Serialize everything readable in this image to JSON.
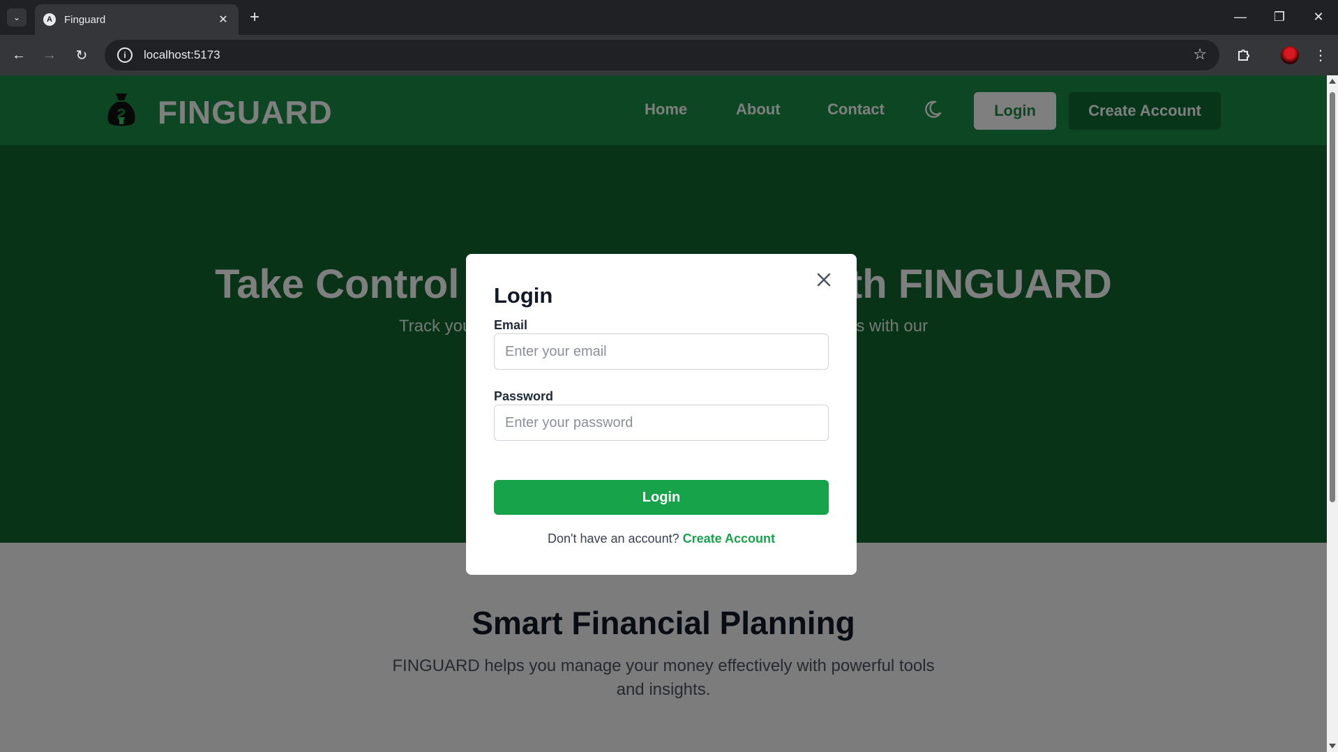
{
  "browser": {
    "tab_title": "Finguard",
    "url": "localhost:5173"
  },
  "site": {
    "brand": "FINGUARD",
    "nav": [
      {
        "label": "Home"
      },
      {
        "label": "About"
      },
      {
        "label": "Contact"
      }
    ],
    "login_label": "Login",
    "create_account_label": "Create Account"
  },
  "hero": {
    "title": "Take Control of Your Finances with FINGUARD",
    "subtitle": "Track your income, expenses, and achieve your financial goals with our"
  },
  "features": {
    "title": "Smart Financial Planning",
    "description": "FINGUARD helps you manage your money effectively with powerful tools and insights."
  },
  "modal": {
    "title": "Login",
    "email_label": "Email",
    "email_placeholder": "Enter your email",
    "password_label": "Password",
    "password_placeholder": "Enter your password",
    "submit_label": "Login",
    "footer_text": "Don't have an account?",
    "footer_link": "Create Account"
  },
  "colors": {
    "header_green": "#1a8d46",
    "hero_green": "#11662f",
    "button_green": "#16a34a",
    "dark_button": "#0f6b35"
  },
  "icons": {
    "theme_toggle": "moon-icon",
    "close": "close-icon",
    "logo": "money-bag-icon"
  }
}
